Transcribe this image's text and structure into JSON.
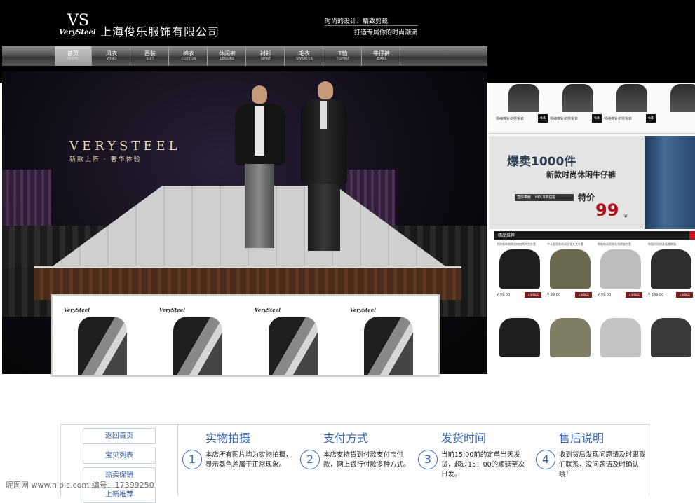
{
  "header": {
    "logo_mark": "VS",
    "logo_text": "VerySteel",
    "company_name": "上海俊乐服饰有限公司",
    "slogan_line1": "时尚的设计、精致剪裁",
    "slogan_line2": "打造专属你的时尚潮流"
  },
  "nav": [
    {
      "label": "首页",
      "sub": "HOME",
      "active": true
    },
    {
      "label": "风衣",
      "sub": "WIND"
    },
    {
      "label": "西装",
      "sub": "SUIT"
    },
    {
      "label": "棉衣",
      "sub": "COTTON"
    },
    {
      "label": "休闲裤",
      "sub": "LEISURE"
    },
    {
      "label": "衬衫",
      "sub": "SHIRT"
    },
    {
      "label": "毛衣",
      "sub": "SWEATER"
    },
    {
      "label": "T恤",
      "sub": "T-SHIRT"
    },
    {
      "label": "牛仔裤",
      "sub": "JEANS"
    }
  ],
  "hero": {
    "brand_title": "VERYSTEEL",
    "brand_sub": "新款上阵 · 奢华体验"
  },
  "products": [
    {
      "brand": "VerySteel"
    },
    {
      "brand": "VerySteel"
    },
    {
      "brand": "VerySteel"
    },
    {
      "brand": "VerySteel"
    }
  ],
  "right_thumbs": [
    {
      "title": "领纯棉针织男毛衣",
      "price": "68"
    },
    {
      "title": "领纯棉针织男毛衣",
      "price": "68"
    },
    {
      "title": "领纯棉针织男毛衣",
      "price": "68"
    },
    {
      "title": "",
      "price": "68"
    }
  ],
  "promo": {
    "headline": "爆卖1000件",
    "sub": "新款时尚休闲牛仔裤",
    "badge_left": "直情奉献",
    "badge_right": "HOLD不住啦",
    "special_label": "特价",
    "price": "99",
    "currency": "¥"
  },
  "featured": {
    "title": "精品推荐",
    "jackets": [
      {
        "title": "冬装新款男装加绒加厚夹克外套",
        "price": "¥ 99.00",
        "button": "立即购买",
        "color": "#1e1e1e"
      },
      {
        "title": "中长款男装休闲立领夹克外套",
        "price": "¥ 99.00",
        "button": "立即购买",
        "color": "#6b6a50"
      },
      {
        "title": "韩版休闲男装毛领棉服外套",
        "price": "¥ 99.00",
        "button": "立即购买",
        "color": "#bdbdbd"
      },
      {
        "title": "韩版时尚修身连帽棉服",
        "price": "¥ 249.00",
        "button": "立即购买",
        "color": "#2e2e2e"
      },
      {
        "title": "",
        "price": "",
        "button": "",
        "color": "#1e1e1e"
      },
      {
        "title": "",
        "price": "",
        "button": "",
        "color": "#7f7e64"
      },
      {
        "title": "",
        "price": "",
        "button": "",
        "color": "#c4c4c4"
      },
      {
        "title": "",
        "price": "",
        "button": "",
        "color": "#3a3a3a"
      }
    ]
  },
  "sidebar_links": [
    "返回首页",
    "宝贝列表",
    "热卖促销",
    "上新推荐"
  ],
  "info_columns": [
    {
      "num": "1",
      "title": "实物拍摄",
      "desc": "本店所有图片均为实物拍摄，显示器色差属于正常现象。"
    },
    {
      "num": "2",
      "title": "支付方式",
      "desc": "本店支持货到付款支付宝付款，网上银行付款多种方式。"
    },
    {
      "num": "3",
      "title": "发货时间",
      "desc": "当前15:00前的定单当天发货，超过15：00的顺延至次日发。"
    },
    {
      "num": "4",
      "title": "售后说明",
      "desc": "收到货后发现问题请及时跟我们联系，没问题请及时确认哦！"
    }
  ],
  "watermark": "昵图网 www.nipic.com    编号：17399250"
}
